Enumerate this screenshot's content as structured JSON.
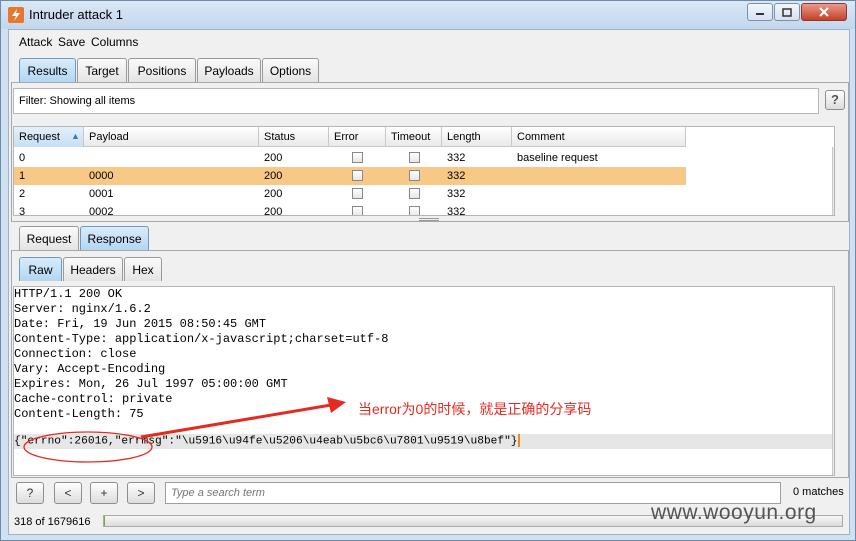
{
  "window": {
    "title": "Intruder attack 1"
  },
  "menu": [
    "Attack",
    "Save",
    "Columns"
  ],
  "top_tabs": [
    {
      "label": "Results",
      "active": true
    },
    {
      "label": "Target",
      "active": false
    },
    {
      "label": "Positions",
      "active": false
    },
    {
      "label": "Payloads",
      "active": false
    },
    {
      "label": "Options",
      "active": false
    }
  ],
  "filter": {
    "text": "Filter:  Showing all items",
    "help": "?"
  },
  "table": {
    "columns": [
      "Request",
      "Payload",
      "Status",
      "Error",
      "Timeout",
      "Length",
      "Comment"
    ],
    "sort_indicator": "▲",
    "rows": [
      {
        "request": "0",
        "payload": "",
        "status": "200",
        "length": "332",
        "comment": "baseline request",
        "selected": false
      },
      {
        "request": "1",
        "payload": "0000",
        "status": "200",
        "length": "332",
        "comment": "",
        "selected": true
      },
      {
        "request": "2",
        "payload": "0001",
        "status": "200",
        "length": "332",
        "comment": "",
        "selected": false
      },
      {
        "request": "3",
        "payload": "0002",
        "status": "200",
        "length": "332",
        "comment": "",
        "selected": false
      }
    ]
  },
  "req_resp_tabs": [
    {
      "label": "Request",
      "active": false
    },
    {
      "label": "Response",
      "active": true
    }
  ],
  "view_tabs": [
    {
      "label": "Raw",
      "active": true
    },
    {
      "label": "Headers",
      "active": false
    },
    {
      "label": "Hex",
      "active": false
    }
  ],
  "response": {
    "lines": [
      "HTTP/1.1 200 OK",
      "Server: nginx/1.6.2",
      "Date: Fri, 19 Jun 2015 08:50:45 GMT",
      "Content-Type: application/x-javascript;charset=utf-8",
      "Connection: close",
      "Vary: Accept-Encoding",
      "Expires: Mon, 26 Jul 1997 05:00:00 GMT",
      "Cache-control: private",
      "Content-Length: 75"
    ],
    "body": "{\"errno\":26016,\"errmsg\":\"\\u5916\\u94fe\\u5206\\u4eab\\u5bc6\\u7801\\u9519\\u8bef\"}"
  },
  "annotation": "当error为0的时候，就是正确的分享码",
  "search": {
    "placeholder": "Type a search term",
    "matches": "0 matches"
  },
  "buttons": {
    "help": "?",
    "prev": "<",
    "add": "+",
    "next": ">"
  },
  "status": {
    "text": "318 of 1679616",
    "progress_fraction": 0.0002
  },
  "watermark": "www.wooyun.org",
  "colors": {
    "selected_row": "#f8c986",
    "annotation": "#e52b20",
    "cursor": "#e88f1a"
  }
}
